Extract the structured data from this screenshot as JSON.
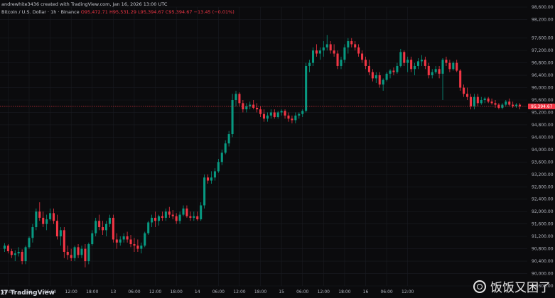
{
  "header": {
    "author_line": "andrewhite3436 created with TradingView.com, Jan 16, 2026 13:00 UTC",
    "symbol": "Bitcoin / U.S. Dollar · 1h · Binance",
    "o": "O95,472.71",
    "h": "H95,531.29",
    "l": "L95,394.67",
    "c": "C95,394.67",
    "chg": "−13.45 (−0.01%)"
  },
  "brand": {
    "logo": "17",
    "name": "TradingView"
  },
  "watermark": "饭饭又困了",
  "colors": {
    "up": "#089981",
    "down": "#f23645",
    "background": "#0b0b0d",
    "grid": "#1a1c22"
  },
  "chart_data": {
    "type": "candlestick",
    "title": "Bitcoin / U.S. Dollar · 1h · Binance",
    "current_price": 95394.67,
    "current_price_label": "95,394.67",
    "ylim": [
      89600,
      98600
    ],
    "y_ticks": [
      "98,600.00",
      "98,200.00",
      "97,600.00",
      "97,200.00",
      "96,800.00",
      "96,400.00",
      "96,000.00",
      "95,600.00",
      "95,200.00",
      "94,800.00",
      "94,400.00",
      "94,000.00",
      "93,600.00",
      "93,200.00",
      "92,800.00",
      "92,400.00",
      "92,000.00",
      "91,600.00",
      "91,200.00",
      "90,800.00",
      "90,400.00",
      "90,000.00",
      "89,600.00"
    ],
    "x_ticks": [
      {
        "label": "18:00",
        "index": 1
      },
      {
        "label": "12",
        "index": 7
      },
      {
        "label": "06:00",
        "index": 13
      },
      {
        "label": "12:00",
        "index": 19
      },
      {
        "label": "18:00",
        "index": 25
      },
      {
        "label": "13",
        "index": 31
      },
      {
        "label": "06:00",
        "index": 37
      },
      {
        "label": "12:00",
        "index": 43
      },
      {
        "label": "18:00",
        "index": 49
      },
      {
        "label": "14",
        "index": 55
      },
      {
        "label": "06:00",
        "index": 61
      },
      {
        "label": "12:00",
        "index": 67
      },
      {
        "label": "18:00",
        "index": 73
      },
      {
        "label": "15",
        "index": 79
      },
      {
        "label": "06:00",
        "index": 85
      },
      {
        "label": "12:00",
        "index": 91
      },
      {
        "label": "18:00",
        "index": 97
      },
      {
        "label": "16",
        "index": 103
      },
      {
        "label": "06:00",
        "index": 109
      },
      {
        "label": "12:00",
        "index": 115
      }
    ],
    "candles": [
      {
        "o": 90800,
        "h": 90980,
        "l": 90700,
        "c": 90900
      },
      {
        "o": 90900,
        "h": 90950,
        "l": 90650,
        "c": 90720
      },
      {
        "o": 90720,
        "h": 90800,
        "l": 90500,
        "c": 90600
      },
      {
        "o": 90600,
        "h": 90750,
        "l": 90400,
        "c": 90650
      },
      {
        "o": 90650,
        "h": 90850,
        "l": 90550,
        "c": 90700
      },
      {
        "o": 90700,
        "h": 90780,
        "l": 90300,
        "c": 90400
      },
      {
        "o": 90400,
        "h": 90900,
        "l": 90300,
        "c": 90850
      },
      {
        "o": 90850,
        "h": 91200,
        "l": 90800,
        "c": 91150
      },
      {
        "o": 91150,
        "h": 91600,
        "l": 91000,
        "c": 91500
      },
      {
        "o": 91500,
        "h": 92100,
        "l": 91400,
        "c": 92000
      },
      {
        "o": 92000,
        "h": 92300,
        "l": 91700,
        "c": 91800
      },
      {
        "o": 91800,
        "h": 92000,
        "l": 91500,
        "c": 91600
      },
      {
        "o": 91600,
        "h": 91900,
        "l": 91400,
        "c": 91750
      },
      {
        "o": 91750,
        "h": 92100,
        "l": 91700,
        "c": 91950
      },
      {
        "o": 91950,
        "h": 92100,
        "l": 91600,
        "c": 91700
      },
      {
        "o": 91700,
        "h": 91900,
        "l": 91100,
        "c": 91200
      },
      {
        "o": 91200,
        "h": 91500,
        "l": 90900,
        "c": 91400
      },
      {
        "o": 91400,
        "h": 91500,
        "l": 90500,
        "c": 90700
      },
      {
        "o": 90700,
        "h": 90900,
        "l": 90450,
        "c": 90600
      },
      {
        "o": 90600,
        "h": 90800,
        "l": 90400,
        "c": 90500
      },
      {
        "o": 90500,
        "h": 90900,
        "l": 90400,
        "c": 90850
      },
      {
        "o": 90850,
        "h": 90950,
        "l": 90500,
        "c": 90600
      },
      {
        "o": 90600,
        "h": 90900,
        "l": 90500,
        "c": 90800
      },
      {
        "o": 90800,
        "h": 90950,
        "l": 90200,
        "c": 90400
      },
      {
        "o": 90400,
        "h": 91000,
        "l": 90300,
        "c": 90950
      },
      {
        "o": 90950,
        "h": 91400,
        "l": 90900,
        "c": 91300
      },
      {
        "o": 91300,
        "h": 91800,
        "l": 91200,
        "c": 91700
      },
      {
        "o": 91700,
        "h": 91900,
        "l": 91400,
        "c": 91500
      },
      {
        "o": 91500,
        "h": 91700,
        "l": 91250,
        "c": 91400
      },
      {
        "o": 91400,
        "h": 91700,
        "l": 91200,
        "c": 91600
      },
      {
        "o": 91600,
        "h": 91900,
        "l": 91500,
        "c": 91800
      },
      {
        "o": 91800,
        "h": 91900,
        "l": 91000,
        "c": 91100
      },
      {
        "o": 91100,
        "h": 91300,
        "l": 90800,
        "c": 91000
      },
      {
        "o": 91000,
        "h": 91200,
        "l": 90900,
        "c": 91100
      },
      {
        "o": 91100,
        "h": 91300,
        "l": 91000,
        "c": 91200
      },
      {
        "o": 91200,
        "h": 91350,
        "l": 91000,
        "c": 91100
      },
      {
        "o": 91100,
        "h": 91250,
        "l": 90850,
        "c": 90950
      },
      {
        "o": 90950,
        "h": 91150,
        "l": 90700,
        "c": 90900
      },
      {
        "o": 90900,
        "h": 91100,
        "l": 90700,
        "c": 90800
      },
      {
        "o": 90800,
        "h": 91000,
        "l": 90650,
        "c": 90900
      },
      {
        "o": 90900,
        "h": 91350,
        "l": 90850,
        "c": 91300
      },
      {
        "o": 91300,
        "h": 91700,
        "l": 91250,
        "c": 91650
      },
      {
        "o": 91650,
        "h": 91900,
        "l": 91500,
        "c": 91800
      },
      {
        "o": 91800,
        "h": 92000,
        "l": 91500,
        "c": 91700
      },
      {
        "o": 91700,
        "h": 91900,
        "l": 91550,
        "c": 91850
      },
      {
        "o": 91850,
        "h": 92000,
        "l": 91700,
        "c": 91800
      },
      {
        "o": 91800,
        "h": 92100,
        "l": 91700,
        "c": 92000
      },
      {
        "o": 92000,
        "h": 92150,
        "l": 91800,
        "c": 91900
      },
      {
        "o": 91900,
        "h": 92050,
        "l": 91750,
        "c": 91850
      },
      {
        "o": 91850,
        "h": 91950,
        "l": 91600,
        "c": 91700
      },
      {
        "o": 91700,
        "h": 92000,
        "l": 91600,
        "c": 91900
      },
      {
        "o": 91900,
        "h": 92200,
        "l": 91850,
        "c": 92100
      },
      {
        "o": 92100,
        "h": 92200,
        "l": 91800,
        "c": 91850
      },
      {
        "o": 91850,
        "h": 92000,
        "l": 91700,
        "c": 91800
      },
      {
        "o": 91800,
        "h": 92000,
        "l": 91700,
        "c": 91850
      },
      {
        "o": 91850,
        "h": 92000,
        "l": 91700,
        "c": 91750
      },
      {
        "o": 91750,
        "h": 92300,
        "l": 91700,
        "c": 92200
      },
      {
        "o": 92200,
        "h": 93200,
        "l": 92100,
        "c": 93100
      },
      {
        "o": 93100,
        "h": 93200,
        "l": 92900,
        "c": 93000
      },
      {
        "o": 93000,
        "h": 93300,
        "l": 92900,
        "c": 93100
      },
      {
        "o": 93100,
        "h": 93400,
        "l": 93000,
        "c": 93300
      },
      {
        "o": 93300,
        "h": 93700,
        "l": 93250,
        "c": 93600
      },
      {
        "o": 93600,
        "h": 94000,
        "l": 93500,
        "c": 93900
      },
      {
        "o": 93900,
        "h": 94300,
        "l": 93850,
        "c": 94200
      },
      {
        "o": 94200,
        "h": 94600,
        "l": 94100,
        "c": 94500
      },
      {
        "o": 94500,
        "h": 95800,
        "l": 94400,
        "c": 95600
      },
      {
        "o": 95600,
        "h": 95900,
        "l": 95400,
        "c": 95800
      },
      {
        "o": 95800,
        "h": 95850,
        "l": 95400,
        "c": 95500
      },
      {
        "o": 95500,
        "h": 95600,
        "l": 95200,
        "c": 95300
      },
      {
        "o": 95300,
        "h": 95500,
        "l": 95200,
        "c": 95400
      },
      {
        "o": 95400,
        "h": 95550,
        "l": 95300,
        "c": 95450
      },
      {
        "o": 95450,
        "h": 95600,
        "l": 95300,
        "c": 95350
      },
      {
        "o": 95350,
        "h": 95500,
        "l": 95200,
        "c": 95300
      },
      {
        "o": 95300,
        "h": 95400,
        "l": 95050,
        "c": 95150
      },
      {
        "o": 95150,
        "h": 95300,
        "l": 94900,
        "c": 95000
      },
      {
        "o": 95000,
        "h": 95200,
        "l": 94900,
        "c": 95100
      },
      {
        "o": 95100,
        "h": 95300,
        "l": 95000,
        "c": 95200
      },
      {
        "o": 95200,
        "h": 95300,
        "l": 95000,
        "c": 95050
      },
      {
        "o": 95050,
        "h": 95250,
        "l": 95000,
        "c": 95200
      },
      {
        "o": 95200,
        "h": 95300,
        "l": 95100,
        "c": 95250
      },
      {
        "o": 95250,
        "h": 95300,
        "l": 95000,
        "c": 95100
      },
      {
        "o": 95100,
        "h": 95200,
        "l": 94900,
        "c": 95000
      },
      {
        "o": 95000,
        "h": 95100,
        "l": 94850,
        "c": 94950
      },
      {
        "o": 94950,
        "h": 95200,
        "l": 94850,
        "c": 95100
      },
      {
        "o": 95100,
        "h": 95200,
        "l": 95000,
        "c": 95150
      },
      {
        "o": 95150,
        "h": 95300,
        "l": 95050,
        "c": 95250
      },
      {
        "o": 95250,
        "h": 96800,
        "l": 95200,
        "c": 96700
      },
      {
        "o": 96700,
        "h": 96900,
        "l": 96500,
        "c": 96800
      },
      {
        "o": 96800,
        "h": 97300,
        "l": 96700,
        "c": 97200
      },
      {
        "o": 97200,
        "h": 97400,
        "l": 97000,
        "c": 97100
      },
      {
        "o": 97100,
        "h": 97300,
        "l": 96900,
        "c": 97200
      },
      {
        "o": 97200,
        "h": 97500,
        "l": 97000,
        "c": 97300
      },
      {
        "o": 97300,
        "h": 97700,
        "l": 97200,
        "c": 97400
      },
      {
        "o": 97400,
        "h": 97500,
        "l": 97100,
        "c": 97200
      },
      {
        "o": 97200,
        "h": 97400,
        "l": 97000,
        "c": 97100
      },
      {
        "o": 97100,
        "h": 97200,
        "l": 96600,
        "c": 96700
      },
      {
        "o": 96700,
        "h": 97000,
        "l": 96600,
        "c": 96900
      },
      {
        "o": 96900,
        "h": 97400,
        "l": 96800,
        "c": 97300
      },
      {
        "o": 97300,
        "h": 97600,
        "l": 97100,
        "c": 97500
      },
      {
        "o": 97500,
        "h": 97600,
        "l": 97300,
        "c": 97400
      },
      {
        "o": 97400,
        "h": 97500,
        "l": 97200,
        "c": 97300
      },
      {
        "o": 97300,
        "h": 97400,
        "l": 97000,
        "c": 97100
      },
      {
        "o": 97100,
        "h": 97200,
        "l": 96800,
        "c": 96900
      },
      {
        "o": 96900,
        "h": 97000,
        "l": 96600,
        "c": 96700
      },
      {
        "o": 96700,
        "h": 96900,
        "l": 96400,
        "c": 96500
      },
      {
        "o": 96500,
        "h": 96600,
        "l": 96200,
        "c": 96300
      },
      {
        "o": 96300,
        "h": 96500,
        "l": 96150,
        "c": 96400
      },
      {
        "o": 96400,
        "h": 96500,
        "l": 96000,
        "c": 96100
      },
      {
        "o": 96100,
        "h": 96300,
        "l": 95900,
        "c": 96250
      },
      {
        "o": 96250,
        "h": 96500,
        "l": 96200,
        "c": 96450
      },
      {
        "o": 96450,
        "h": 96600,
        "l": 96300,
        "c": 96550
      },
      {
        "o": 96550,
        "h": 96650,
        "l": 96400,
        "c": 96500
      },
      {
        "o": 96500,
        "h": 96800,
        "l": 96450,
        "c": 96700
      },
      {
        "o": 96700,
        "h": 97250,
        "l": 96650,
        "c": 97150
      },
      {
        "o": 97150,
        "h": 97200,
        "l": 96700,
        "c": 96800
      },
      {
        "o": 96800,
        "h": 97000,
        "l": 96500,
        "c": 96900
      },
      {
        "o": 96900,
        "h": 97000,
        "l": 96500,
        "c": 96600
      },
      {
        "o": 96600,
        "h": 96800,
        "l": 96400,
        "c": 96700
      },
      {
        "o": 96700,
        "h": 96950,
        "l": 96600,
        "c": 96850
      },
      {
        "o": 96850,
        "h": 97050,
        "l": 96700,
        "c": 96900
      },
      {
        "o": 96900,
        "h": 97000,
        "l": 96600,
        "c": 96700
      },
      {
        "o": 96700,
        "h": 96800,
        "l": 96300,
        "c": 96400
      },
      {
        "o": 96400,
        "h": 96600,
        "l": 96300,
        "c": 96500
      },
      {
        "o": 96500,
        "h": 96700,
        "l": 96450,
        "c": 96600
      },
      {
        "o": 96600,
        "h": 96700,
        "l": 96300,
        "c": 96450
      },
      {
        "o": 96450,
        "h": 96950,
        "l": 95600,
        "c": 96900
      },
      {
        "o": 96900,
        "h": 97000,
        "l": 96700,
        "c": 96800
      },
      {
        "o": 96800,
        "h": 96900,
        "l": 96500,
        "c": 96600
      },
      {
        "o": 96600,
        "h": 96850,
        "l": 96550,
        "c": 96800
      },
      {
        "o": 96800,
        "h": 96900,
        "l": 96500,
        "c": 96550
      },
      {
        "o": 96550,
        "h": 96600,
        "l": 95900,
        "c": 96000
      },
      {
        "o": 96000,
        "h": 96100,
        "l": 95700,
        "c": 95800
      },
      {
        "o": 95800,
        "h": 96000,
        "l": 95600,
        "c": 95700
      },
      {
        "o": 95700,
        "h": 95800,
        "l": 95300,
        "c": 95400
      },
      {
        "o": 95400,
        "h": 95800,
        "l": 95300,
        "c": 95700
      },
      {
        "o": 95700,
        "h": 95800,
        "l": 95400,
        "c": 95500
      },
      {
        "o": 95500,
        "h": 95700,
        "l": 95450,
        "c": 95600
      },
      {
        "o": 95600,
        "h": 95700,
        "l": 95500,
        "c": 95650
      },
      {
        "o": 95650,
        "h": 95700,
        "l": 95500,
        "c": 95550
      },
      {
        "o": 95550,
        "h": 95650,
        "l": 95450,
        "c": 95500
      },
      {
        "o": 95500,
        "h": 95600,
        "l": 95350,
        "c": 95450
      },
      {
        "o": 95450,
        "h": 95500,
        "l": 95300,
        "c": 95350
      },
      {
        "o": 95350,
        "h": 95500,
        "l": 95300,
        "c": 95450
      },
      {
        "o": 95450,
        "h": 95600,
        "l": 95400,
        "c": 95550
      },
      {
        "o": 95550,
        "h": 95650,
        "l": 95400,
        "c": 95450
      },
      {
        "o": 95450,
        "h": 95550,
        "l": 95350,
        "c": 95400
      },
      {
        "o": 95400,
        "h": 95500,
        "l": 95350,
        "c": 95450
      },
      {
        "o": 95450,
        "h": 95500,
        "l": 95300,
        "c": 95394.67
      }
    ]
  }
}
